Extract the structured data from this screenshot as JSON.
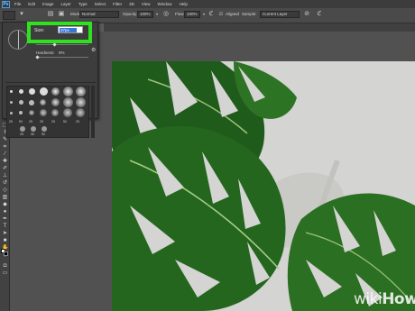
{
  "app": {
    "logo_text": "Ps",
    "menus": [
      "File",
      "Edit",
      "Image",
      "Layer",
      "Type",
      "Select",
      "Filter",
      "3D",
      "View",
      "Window",
      "Help"
    ]
  },
  "options_bar": {
    "mode_label": "Mode:",
    "mode_value": "Normal",
    "opacity_label": "Opacity:",
    "opacity_value": "100%",
    "flow_label": "Flow:",
    "flow_value": "100%",
    "aligned_label": "Aligned",
    "sample_label": "Sample:",
    "sample_value": "Current Layer"
  },
  "document_tab": {
    "label": "x"
  },
  "brush_panel": {
    "size_label": "Size:",
    "size_value": "37px",
    "hardness_label": "Hardness:",
    "hardness_value": "0%",
    "brush_row_numbers": [
      "25",
      "50",
      "25",
      "25",
      "25",
      "50",
      "25",
      "25"
    ],
    "last_row_numbers": [
      "25",
      "35",
      "50"
    ]
  },
  "highlight": {
    "color": "#2ee21f"
  },
  "watermark": {
    "wiki": "wiki",
    "how": "How"
  },
  "icons": {
    "tools": [
      "move-tool-icon",
      "marquee-tool-icon",
      "lasso-tool-icon",
      "quick-select-tool-icon",
      "crop-tool-icon",
      "eyedropper-tool-icon",
      "healing-brush-tool-icon",
      "brush-tool-icon",
      "clone-stamp-tool-icon",
      "history-brush-tool-icon",
      "eraser-tool-icon",
      "gradient-tool-icon",
      "blur-tool-icon",
      "dodge-tool-icon",
      "pen-tool-icon",
      "type-tool-icon",
      "path-select-tool-icon",
      "shape-tool-icon",
      "hand-tool-icon",
      "zoom-tool-icon"
    ]
  }
}
